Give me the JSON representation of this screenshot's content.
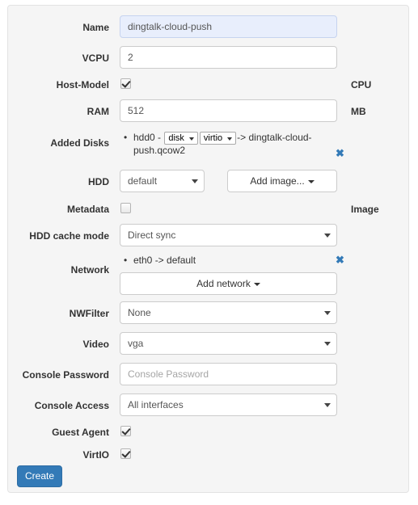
{
  "form": {
    "fields": {
      "name": {
        "label": "Name",
        "value": "dingtalk-cloud-push"
      },
      "vcpu": {
        "label": "VCPU",
        "value": "2",
        "unit": "CPU"
      },
      "host_model": {
        "label": "Host-Model",
        "checked": true
      },
      "ram": {
        "label": "RAM",
        "value": "512",
        "unit": "MB"
      },
      "added_disks": {
        "label": "Added Disks",
        "item": {
          "prefix": "hdd0 - ",
          "device": "disk",
          "bus": "virtio",
          "suffix": "-> dingtalk-cloud-push.qcow2",
          "remove": "✖"
        }
      },
      "hdd": {
        "label": "HDD",
        "value": "default",
        "add_image_label": "Add image..."
      },
      "metadata": {
        "label": "Metadata",
        "checked": false,
        "unit": "Image"
      },
      "hdd_cache_mode": {
        "label": "HDD cache mode",
        "value": "Direct sync"
      },
      "network": {
        "label": "Network",
        "item": {
          "text": "eth0 -> default",
          "remove": "✖"
        },
        "add_network_label": "Add network"
      },
      "nwfilter": {
        "label": "NWFilter",
        "value": "None"
      },
      "video": {
        "label": "Video",
        "value": "vga"
      },
      "console_password": {
        "label": "Console Password",
        "value": "",
        "placeholder": "Console Password"
      },
      "console_access": {
        "label": "Console Access",
        "value": "All interfaces"
      },
      "guest_agent": {
        "label": "Guest Agent",
        "checked": true
      },
      "virtio": {
        "label": "VirtIO",
        "checked": true
      }
    },
    "submit_label": "Create"
  },
  "colors": {
    "panel_bg": "#f5f5f5",
    "panel_border": "#e3e3e3",
    "primary": "#337ab7",
    "link": "#337ab7",
    "autofill_bg": "#e8eefc",
    "input_border": "#cccccc",
    "text": "#333333",
    "muted": "#555555",
    "placeholder": "#a5a5a5"
  }
}
